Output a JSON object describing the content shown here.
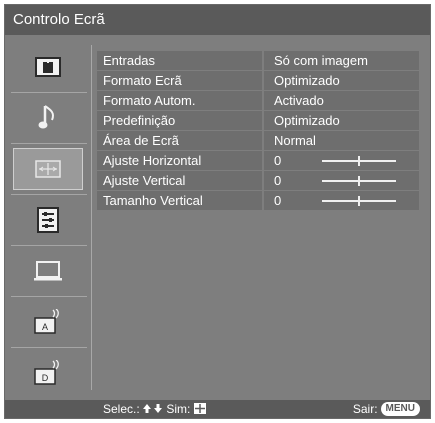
{
  "title": "Controlo Ecrã",
  "sidebar": {
    "icons": [
      {
        "name": "picture-icon"
      },
      {
        "name": "sound-icon"
      },
      {
        "name": "screen-icon"
      },
      {
        "name": "setup-icon"
      },
      {
        "name": "pc-icon"
      },
      {
        "name": "analog-setup-icon"
      },
      {
        "name": "digital-setup-icon"
      }
    ],
    "active_index": 2
  },
  "menu": {
    "rows": [
      {
        "label": "Entradas",
        "value": "Só com imagem",
        "slider": false
      },
      {
        "label": "Formato Ecrã",
        "value": "Optimizado",
        "slider": false
      },
      {
        "label": "Formato Autom.",
        "value": "Activado",
        "slider": false
      },
      {
        "label": "Predefinição",
        "value": "Optimizado",
        "slider": false
      },
      {
        "label": "Área de Ecrã",
        "value": "Normal",
        "slider": false
      },
      {
        "label": "Ajuste Horizontal",
        "value": "0",
        "slider": true,
        "level": 0.5
      },
      {
        "label": "Ajuste Vertical",
        "value": "0",
        "slider": true,
        "level": 0.5
      },
      {
        "label": "Tamanho Vertical",
        "value": "0",
        "slider": true,
        "level": 0.5
      }
    ]
  },
  "footer": {
    "select_text": "Selec.:",
    "confirm_text": "Sim:",
    "exit_text": "Sair:",
    "menu_button": "MENU"
  }
}
